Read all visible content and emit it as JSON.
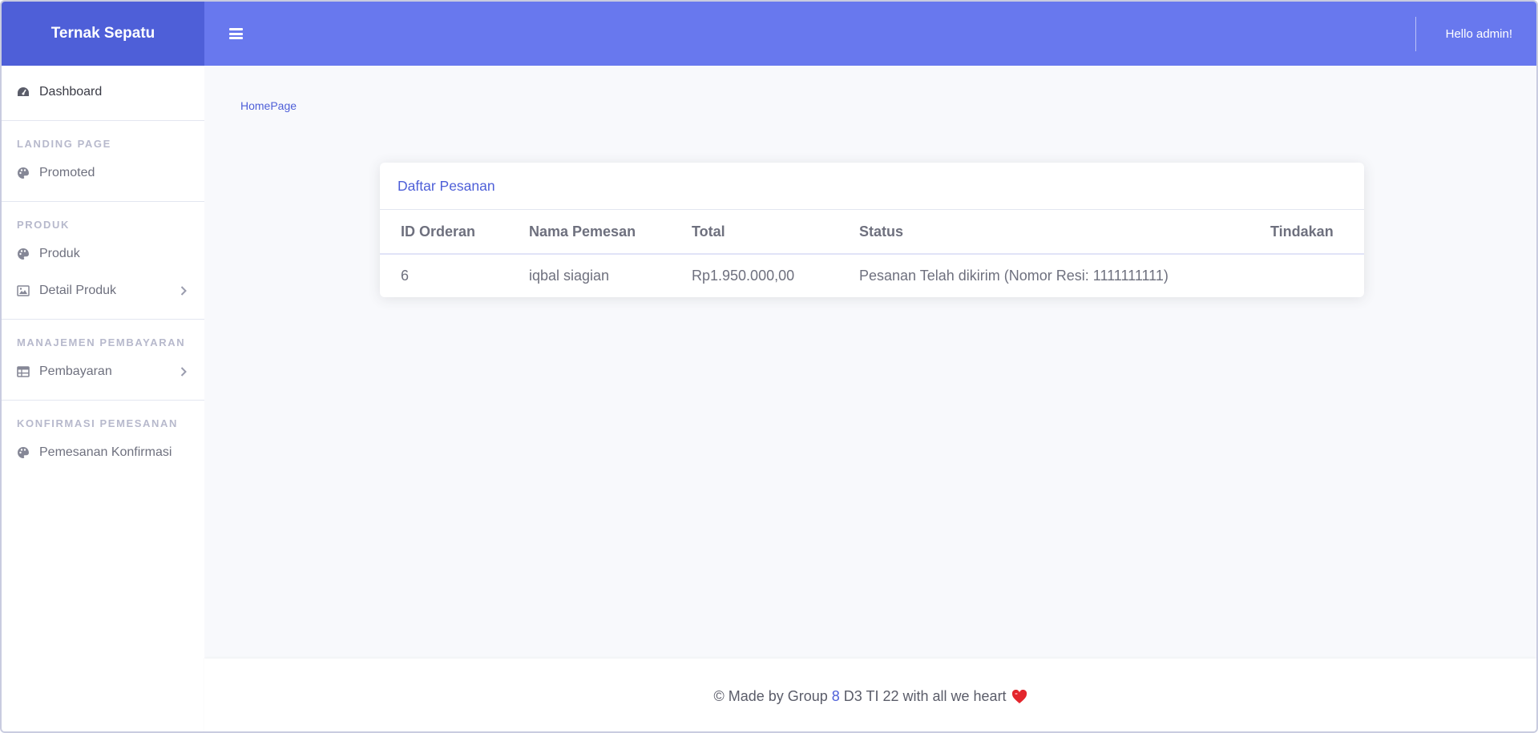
{
  "sidebar": {
    "brand": "Ternak Sepatu",
    "dashboard": "Dashboard",
    "sections": [
      {
        "heading": "LANDING PAGE",
        "items": [
          {
            "label": "Promoted"
          }
        ]
      },
      {
        "heading": "PRODUK",
        "items": [
          {
            "label": "Produk"
          },
          {
            "label": "Detail Produk"
          }
        ]
      },
      {
        "heading": "MANAJEMEN PEMBAYARAN",
        "items": [
          {
            "label": "Pembayaran"
          }
        ]
      },
      {
        "heading": "KONFIRMASI PEMESANAN",
        "items": [
          {
            "label": "Pemesanan Konfirmasi"
          }
        ]
      }
    ]
  },
  "topbar": {
    "greeting": "Hello admin!"
  },
  "breadcrumb": "HomePage",
  "card": {
    "title": "Daftar Pesanan",
    "columns": [
      "ID Orderan",
      "Nama Pemesan",
      "Total",
      "Status",
      "Tindakan"
    ],
    "rows": [
      {
        "id": "6",
        "name": "iqbal siagian",
        "total": "Rp1.950.000,00",
        "status": "Pesanan Telah dikirim (Nomor Resi: 1111111111)",
        "action": ""
      }
    ]
  },
  "footer": {
    "prefix": "© Made by Group",
    "group_number": "8",
    "suffix": "D3 TI 22 with all we heart"
  },
  "colors": {
    "brand": "#4e5fd8",
    "topbar": "#6878ee",
    "heart": "#e3262d"
  },
  "icons": {
    "dashboard": "tachometer-icon",
    "palette": "palette-icon",
    "detail": "image-icon",
    "table": "table-icon",
    "chevron": "chevron-right-icon",
    "menu": "bars-icon",
    "heart": "heart-icon"
  }
}
